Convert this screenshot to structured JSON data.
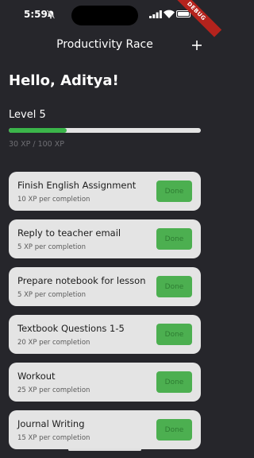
{
  "status_bar": {
    "time": "5:59",
    "debug_label": "DEBUG"
  },
  "app_bar": {
    "title": "Productivity Race",
    "add_icon": "plus-icon"
  },
  "greeting": "Hello, Aditya!",
  "level": {
    "label": "Level 5",
    "xp_text": "30 XP / 100 XP",
    "progress": 0.3
  },
  "colors": {
    "background": "#26262b",
    "accent": "#3bb54a",
    "card": "#e4e4e4",
    "done_button": "#4caf50"
  },
  "tasks": [
    {
      "title": "Finish English Assignment",
      "xp": "10 XP per completion",
      "button": "Done"
    },
    {
      "title": "Reply to teacher email",
      "xp": "5 XP per completion",
      "button": "Done"
    },
    {
      "title": "Prepare notebook for lesson",
      "xp": "5 XP per completion",
      "button": "Done"
    },
    {
      "title": "Textbook Questions 1-5",
      "xp": "20 XP per completion",
      "button": "Done"
    },
    {
      "title": "Workout",
      "xp": "25 XP per completion",
      "button": "Done"
    },
    {
      "title": "Journal Writing",
      "xp": "15 XP per completion",
      "button": "Done"
    }
  ]
}
